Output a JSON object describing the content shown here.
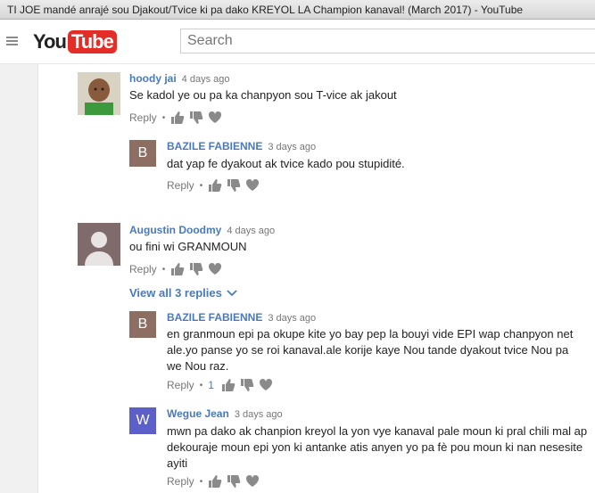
{
  "window": {
    "title": "TI JOE mandé anrajé sou Djakout/Tvice ki pa dako KREYOL LA Champion kanaval! (March 2017) - YouTube"
  },
  "masthead": {
    "logo_you": "You",
    "logo_tube": "Tube",
    "search_placeholder": "Search"
  },
  "comments": [
    {
      "author": "hoody jai",
      "time": "4 days ago",
      "text": "Se kadol ye ou pa ka chanpyon sou T-vice ak jakout",
      "reply": "Reply"
    },
    {
      "author": "BAZILE FABIENNE",
      "initial": "B",
      "time": "3 days ago",
      "text": "dat yap fe dyakout ak tvice kado pou stupidité.",
      "reply": "Reply",
      "avatar_color": "#8c6f62"
    },
    {
      "author": "Augustin Doodmy",
      "time": "4 days ago",
      "text": "ou fini wi GRANMOUN",
      "reply": "Reply",
      "view_replies": "View all 3 replies"
    },
    {
      "author": "BAZILE FABIENNE",
      "initial": "B",
      "time": "3 days ago",
      "text": "en granmoun epi pa okupe kite yo bay pep la bouyi vide EPI wap chanpyon net ale.yo panse yo se roi kanaval.ale korije kaye Nou tande dyakout tvice Nou pa we Nou raz.",
      "reply": "Reply",
      "likes": "1",
      "avatar_color": "#8c6f62"
    },
    {
      "author": "Wegue Jean",
      "initial": "W",
      "time": "3 days ago",
      "text": "mwn pa dako ak chanpion kreyol la yon vye kanaval pale moun ki pral chili mal ap dekouraje moun epi yon ki antanke atis anyen yo pa fè pou moun ki nan nesesite ayiti",
      "reply": "Reply",
      "avatar_color": "#5b5fc7"
    }
  ]
}
